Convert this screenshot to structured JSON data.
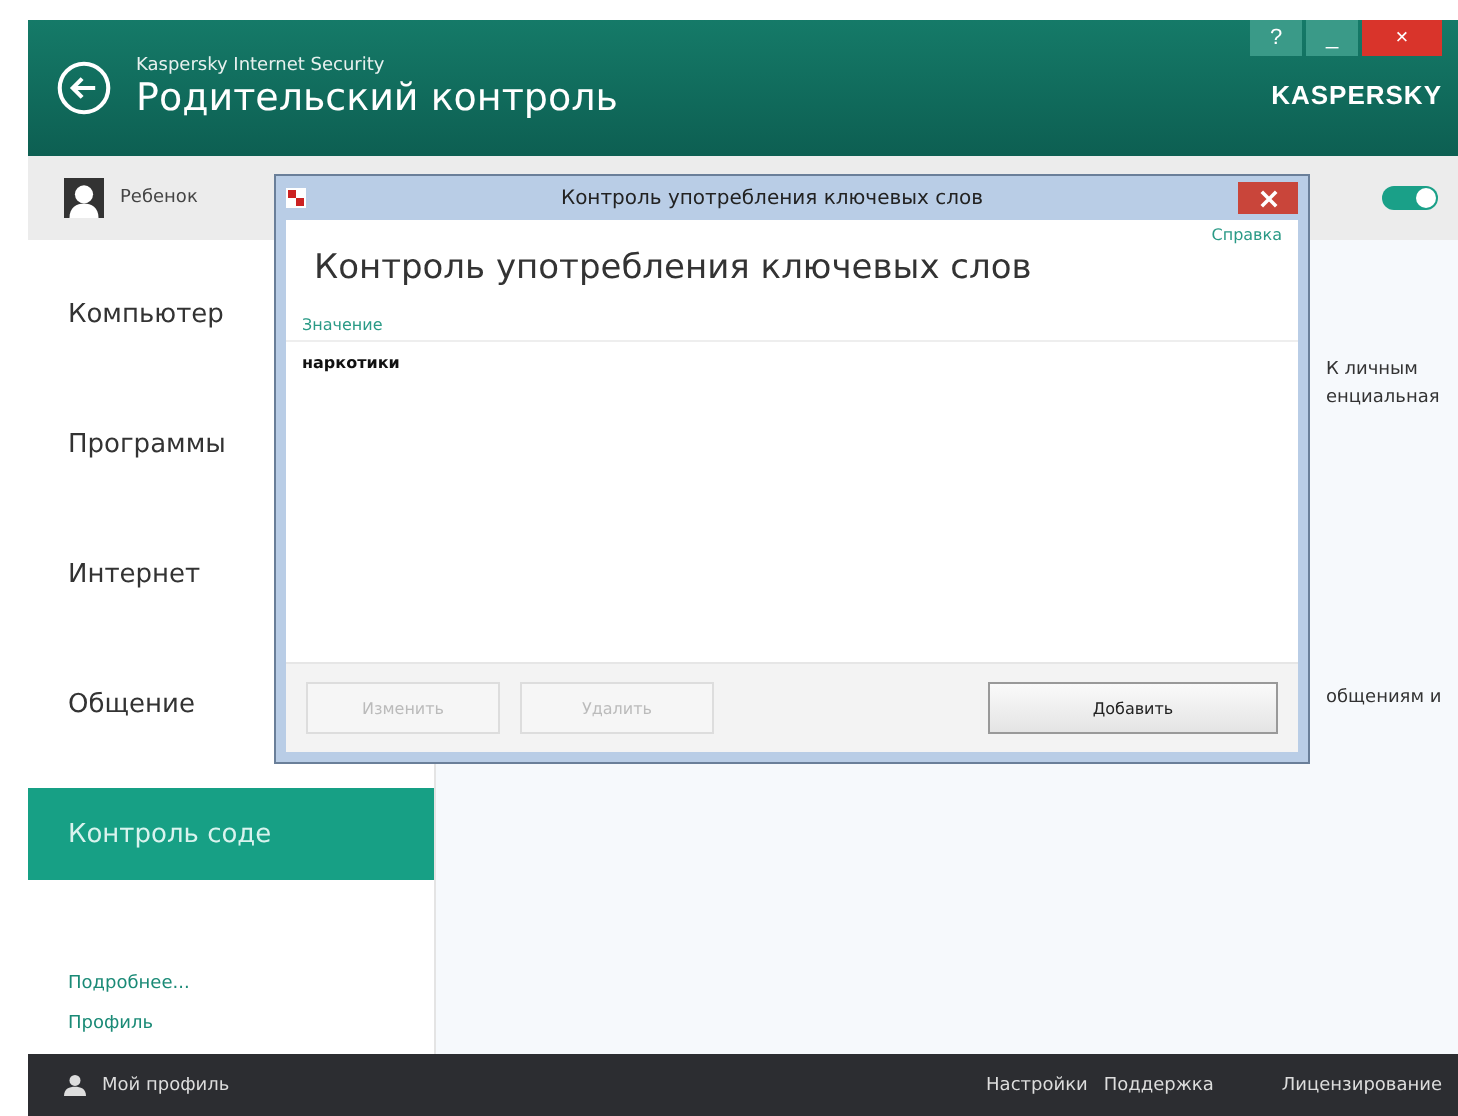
{
  "window": {
    "product": "Kaspersky Internet Security",
    "title": "Родительский контроль",
    "logo": "KASPERSKY",
    "controls": [
      "?",
      "_",
      "×"
    ]
  },
  "user": {
    "name": "Ребенок",
    "toggle_on": true
  },
  "sidebar": {
    "items": [
      {
        "label": "Компьютер",
        "selected": false
      },
      {
        "label": "Программы",
        "selected": false
      },
      {
        "label": "Интернет",
        "selected": false
      },
      {
        "label": "Общение",
        "selected": false
      },
      {
        "label": "Контроль соде",
        "selected": true
      }
    ],
    "links": [
      "Подробнее...",
      "Профиль"
    ]
  },
  "content": {
    "fragments": [
      "К личным",
      "енциальная",
      "общениям и"
    ]
  },
  "dialog": {
    "title": "Контроль употребления ключевых слов",
    "help": "Справка",
    "heading": "Контроль употребления ключевых слов",
    "column": "Значение",
    "rows": [
      "наркотики"
    ],
    "buttons": [
      {
        "label": "Изменить",
        "disabled": true
      },
      {
        "label": "Удалить",
        "disabled": true
      },
      {
        "label": "Добавить",
        "disabled": false
      }
    ]
  },
  "footer": {
    "profile": "Мой профиль",
    "links": [
      "Настройки",
      "Поддержка"
    ],
    "license": "Лицензирование"
  }
}
